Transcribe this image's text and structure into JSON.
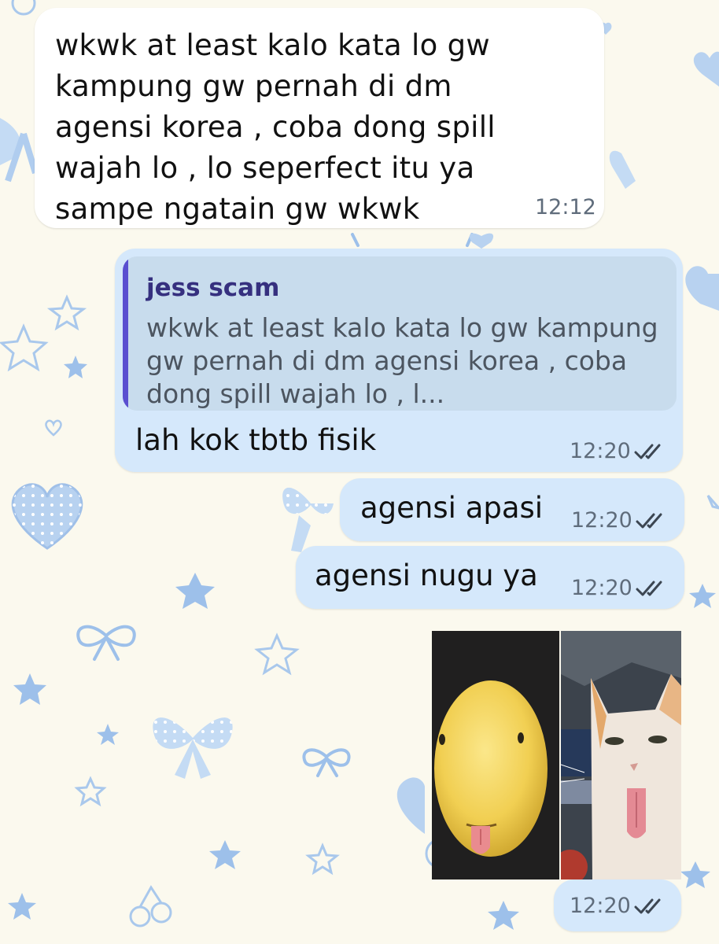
{
  "messages": {
    "incoming": {
      "text": "wkwk at least kalo kata lo gw kampung gw pernah di dm agensi korea , coba dong spill wajah lo , lo seperfect itu ya sampe ngatain gw wkwk",
      "time": "12:12"
    },
    "reply": {
      "quoted_name": "jess scam",
      "quoted_text": "wkwk at least kalo kata lo gw kampung gw pernah di dm agensi korea , coba dong spill wajah lo , l...",
      "text": "lah kok tbtb fisik",
      "time": "12:20",
      "status_icon": "double-check-icon"
    },
    "out2": {
      "text": "agensi apasi",
      "time": "12:20",
      "status_icon": "double-check-icon"
    },
    "out3": {
      "text": "agensi nugu ya",
      "time": "12:20",
      "status_icon": "double-check-icon"
    },
    "media": {
      "panels": [
        "emoji-tongue-out-face",
        "cat-tongue-out-photo"
      ],
      "time": "12:20",
      "status_icon": "double-check-icon"
    }
  },
  "colors": {
    "wallpaper": "#fbf9ee",
    "incoming_bubble": "#ffffff",
    "outgoing_bubble": "#d5e8fb",
    "quote_background": "#c8dced",
    "quote_accent": "#5a4fd0",
    "quote_name": "#36307f",
    "timestamp": "#5f6c7b",
    "wallpaper_motif": "#a9c8ec"
  }
}
